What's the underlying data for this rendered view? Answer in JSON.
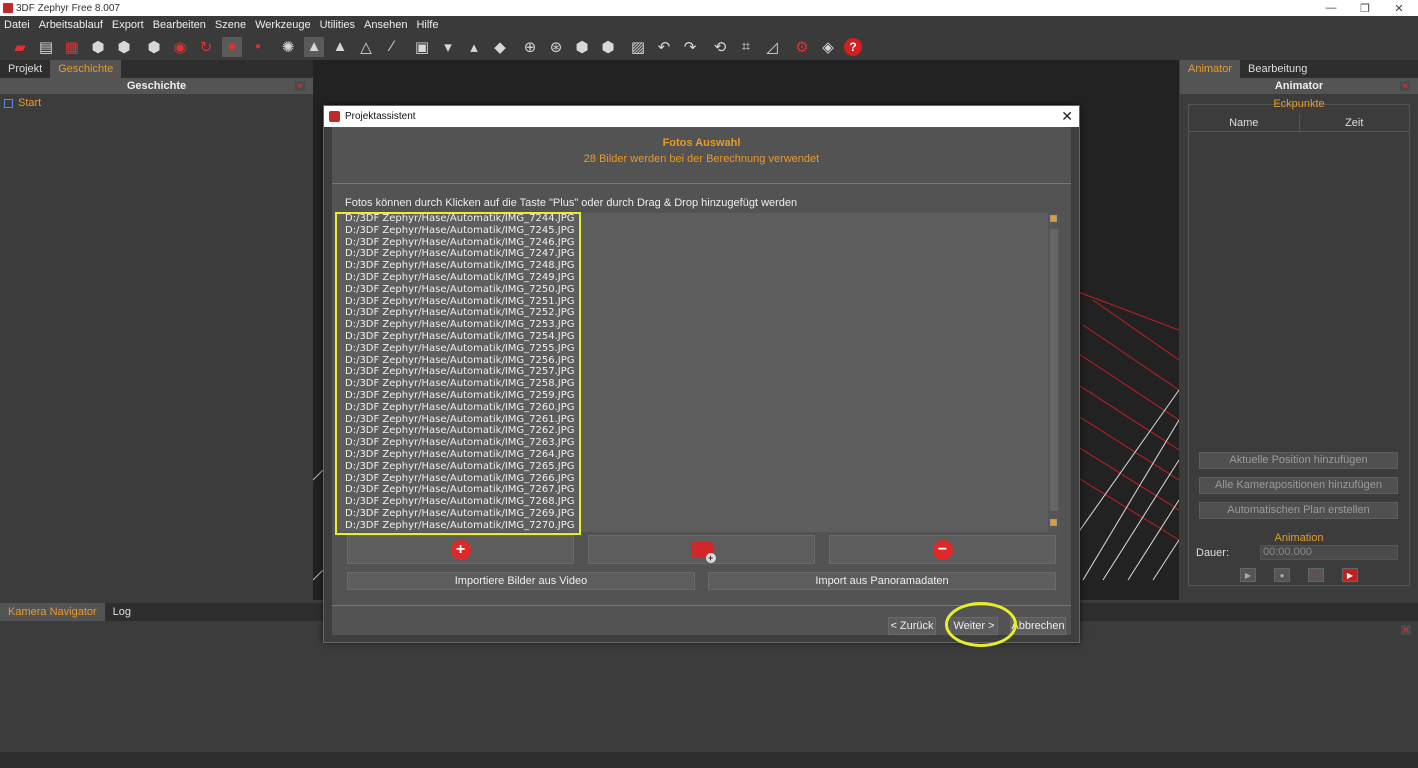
{
  "window": {
    "title": "3DF Zephyr Free 8.007",
    "minimize": "—",
    "restore": "❐",
    "close": "✕"
  },
  "menu": [
    "Datei",
    "Arbeitsablauf",
    "Export",
    "Bearbeiten",
    "Szene",
    "Werkzeuge",
    "Utilities",
    "Ansehen",
    "Hilfe"
  ],
  "left_panel": {
    "tabs": [
      "Projekt",
      "Geschichte"
    ],
    "active_tab": "Geschichte",
    "title": "Geschichte",
    "close": "✕",
    "history": [
      {
        "label": "Start"
      }
    ]
  },
  "right_panel": {
    "tabs": [
      "Animator",
      "Bearbeitung"
    ],
    "active_tab": "Animator",
    "title": "Animator",
    "close": "✕",
    "keyframes_legend": "Eckpunkte",
    "columns": [
      "Name",
      "Zeit"
    ],
    "buttons": [
      "Aktuelle Position hinzufügen",
      "Alle Kamerapositionen hinzufügen",
      "Automatischen Plan erstellen"
    ],
    "animation_legend": "Animation",
    "duration_label": "Dauer:",
    "duration_value": "00:00.000"
  },
  "bottom_panel": {
    "tabs": [
      "Kamera Navigator",
      "Log"
    ],
    "active_tab": "Kamera Navigator",
    "close": "✕"
  },
  "dialog": {
    "title": "Projektassistent",
    "close": "✕",
    "heading": "Fotos Auswahl",
    "subheading": "28 Bilder werden bei der Berechnung verwendet",
    "hint": "Fotos können durch Klicken auf die Taste \"Plus\" oder durch Drag & Drop hinzugefügt werden",
    "files": [
      "D:/3DF Zephyr/Hase/Automatik/IMG_7244.JPG",
      "D:/3DF Zephyr/Hase/Automatik/IMG_7245.JPG",
      "D:/3DF Zephyr/Hase/Automatik/IMG_7246.JPG",
      "D:/3DF Zephyr/Hase/Automatik/IMG_7247.JPG",
      "D:/3DF Zephyr/Hase/Automatik/IMG_7248.JPG",
      "D:/3DF Zephyr/Hase/Automatik/IMG_7249.JPG",
      "D:/3DF Zephyr/Hase/Automatik/IMG_7250.JPG",
      "D:/3DF Zephyr/Hase/Automatik/IMG_7251.JPG",
      "D:/3DF Zephyr/Hase/Automatik/IMG_7252.JPG",
      "D:/3DF Zephyr/Hase/Automatik/IMG_7253.JPG",
      "D:/3DF Zephyr/Hase/Automatik/IMG_7254.JPG",
      "D:/3DF Zephyr/Hase/Automatik/IMG_7255.JPG",
      "D:/3DF Zephyr/Hase/Automatik/IMG_7256.JPG",
      "D:/3DF Zephyr/Hase/Automatik/IMG_7257.JPG",
      "D:/3DF Zephyr/Hase/Automatik/IMG_7258.JPG",
      "D:/3DF Zephyr/Hase/Automatik/IMG_7259.JPG",
      "D:/3DF Zephyr/Hase/Automatik/IMG_7260.JPG",
      "D:/3DF Zephyr/Hase/Automatik/IMG_7261.JPG",
      "D:/3DF Zephyr/Hase/Automatik/IMG_7262.JPG",
      "D:/3DF Zephyr/Hase/Automatik/IMG_7263.JPG",
      "D:/3DF Zephyr/Hase/Automatik/IMG_7264.JPG",
      "D:/3DF Zephyr/Hase/Automatik/IMG_7265.JPG",
      "D:/3DF Zephyr/Hase/Automatik/IMG_7266.JPG",
      "D:/3DF Zephyr/Hase/Automatik/IMG_7267.JPG",
      "D:/3DF Zephyr/Hase/Automatik/IMG_7268.JPG",
      "D:/3DF Zephyr/Hase/Automatik/IMG_7269.JPG",
      "D:/3DF Zephyr/Hase/Automatik/IMG_7270.JPG"
    ],
    "import_video": "Importiere Bilder aus Video",
    "import_panorama": "Import aus Panoramadaten",
    "back": "< Zurück",
    "next": "Weiter >",
    "cancel": "Abbrechen"
  },
  "colors": {
    "accent": "#e89a2a",
    "highlight": "#e8ef2a",
    "danger": "#e02828"
  }
}
